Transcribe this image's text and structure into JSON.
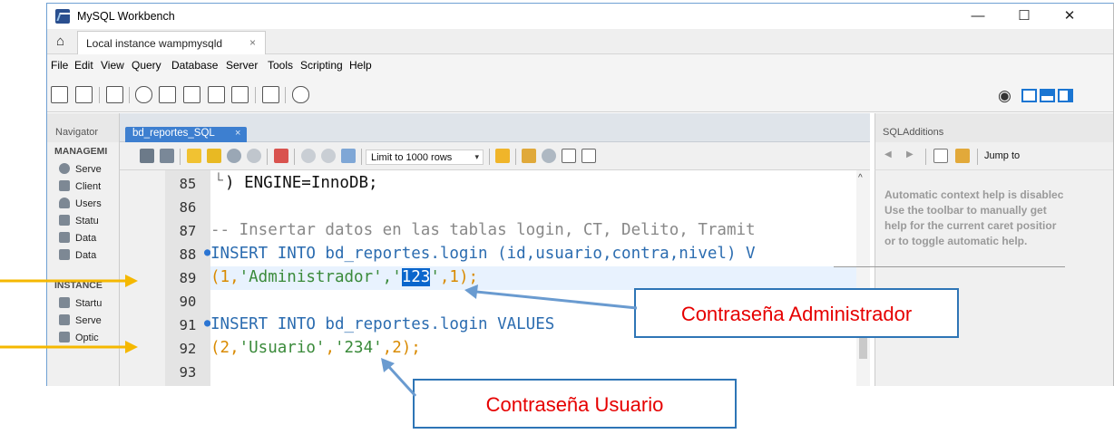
{
  "window": {
    "title": "MySQL Workbench",
    "minimize": "—",
    "maximize": "☐",
    "close": "✕"
  },
  "tab": {
    "label": "Local instance wampmysqld",
    "close": "×"
  },
  "menu": [
    "File",
    "Edit",
    "View",
    "Query",
    "Database",
    "Server",
    "Tools",
    "Scripting",
    "Help"
  ],
  "navigator": {
    "header": "Navigator",
    "management_label": "MANAGEMI",
    "management_items": [
      "Serve",
      "Client",
      "Users",
      "Statu",
      "Data",
      "Data"
    ],
    "instance_label": "INSTANCE",
    "instance_items": [
      "Startu",
      "Serve",
      "Optic"
    ]
  },
  "editor": {
    "tab_label": "bd_reportes_SQL",
    "tab_close": "×",
    "limit_label": "Limit to 1000 rows",
    "line_numbers": [
      "85",
      "86",
      "87",
      "88",
      "89",
      "90",
      "91",
      "92",
      "93"
    ],
    "fold_marker": "└",
    "code": {
      "l85": ") ENGINE=InnoDB;",
      "l87": "-- Insertar datos en las tablas login, CT, Delito, Tramit",
      "l88": "INSERT INTO bd_reportes.login (id,usuario,contra,nivel) V",
      "l89_a": "(1,",
      "l89_b": "'Administrador'",
      "l89_c": ",'",
      "l89_d": "123",
      "l89_e": "'",
      "l89_f": ",1);",
      "l91": "INSERT INTO bd_reportes.login VALUES",
      "l92_a": "(2,",
      "l92_b": "'Usuario'",
      "l92_c": ",",
      "l92_d": "'234'",
      "l92_e": ",2);"
    }
  },
  "sql_additions": {
    "header": "SQLAdditions",
    "jump_to": "Jump to",
    "help_lines": [
      "Automatic context help is disablec",
      "Use the toolbar to manually get",
      "help for the current caret positior",
      "or to toggle automatic help."
    ]
  },
  "annotations": {
    "callout1": "Contraseña Administrador",
    "callout2": "Contraseña Usuario"
  },
  "colors": {
    "keyword": "#2b6cb0",
    "string": "#3a8a3a",
    "number": "#d98a00",
    "comment": "#888888",
    "selection": "#0a66cc",
    "arrow_blue": "#6a9bd0",
    "arrow_orange": "#f5b800",
    "callout_text": "#e60000"
  }
}
